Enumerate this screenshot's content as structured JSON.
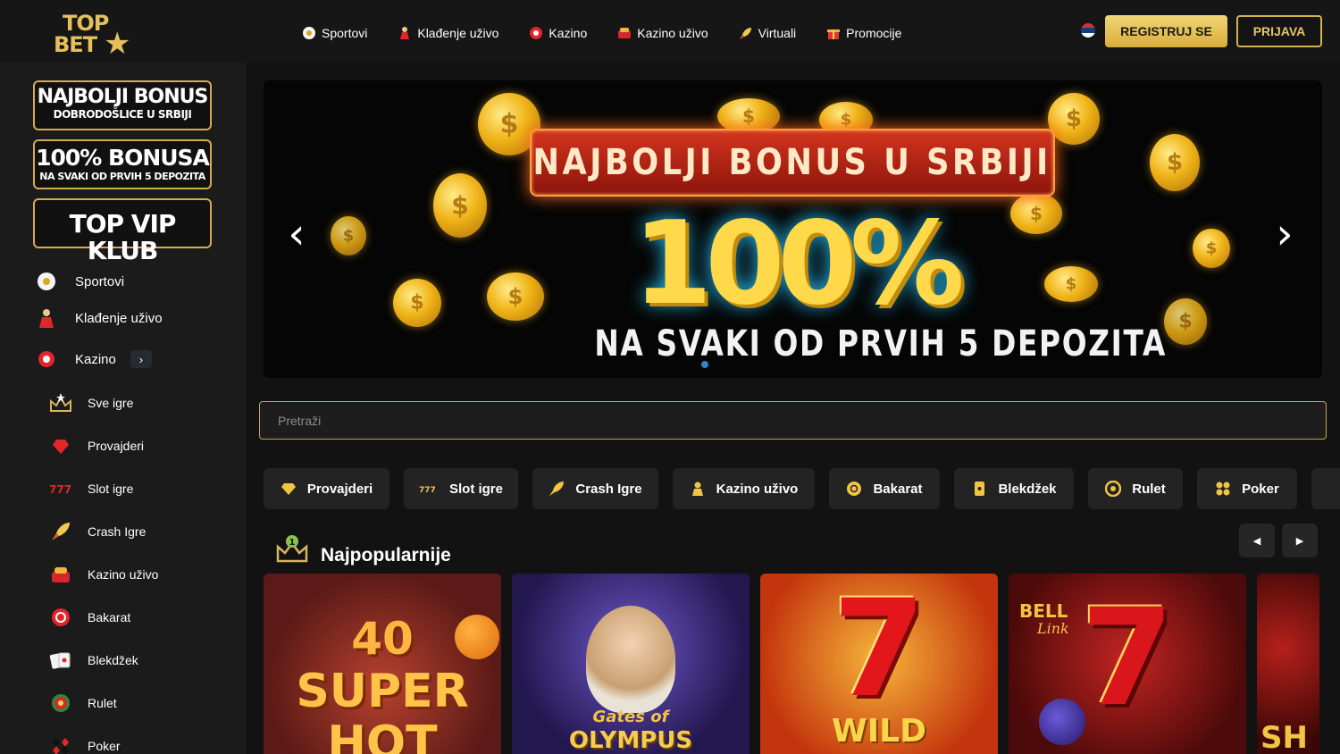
{
  "brand": {
    "line1": "TOP",
    "line2": "BET",
    "star": "★"
  },
  "topnav": [
    {
      "label": "Sportovi",
      "icon": "soccer-ball-icon"
    },
    {
      "label": "Klađenje uživo",
      "icon": "live-player-icon"
    },
    {
      "label": "Kazino",
      "icon": "casino-chip-icon"
    },
    {
      "label": "Kazino uživo",
      "icon": "live-casino-icon"
    },
    {
      "label": "Virtuali",
      "icon": "rocket-icon"
    },
    {
      "label": "Promocije",
      "icon": "gift-icon"
    }
  ],
  "header": {
    "register_label": "REGISTRUJ SE",
    "login_label": "PRIJAVA",
    "language_icon": "serbia-flag-icon"
  },
  "sidebar": {
    "promos": [
      {
        "big": "NAJBOLJI BONUS",
        "small": "DOBRODOŠLICE U SRBIJI"
      },
      {
        "big": "100% BONUSA",
        "small": "NA SVAKI OD PRVIH 5 DEPOZITA"
      },
      {
        "big": "TOP VIP KLUB",
        "small": ""
      }
    ],
    "main_items": [
      {
        "label": "Sportovi",
        "icon": "soccer-ball-icon"
      },
      {
        "label": "Klađenje uživo",
        "icon": "live-player-icon"
      },
      {
        "label": "Kazino",
        "icon": "casino-chip-icon",
        "expand": "›"
      }
    ],
    "sub_items": [
      {
        "label": "Sve igre",
        "icon": "crown-star-icon"
      },
      {
        "label": "Provajderi",
        "icon": "diamond-heart-icon"
      },
      {
        "label": "Slot igre",
        "icon": "triple-seven-icon"
      },
      {
        "label": "Crash Igre",
        "icon": "rocket-icon"
      },
      {
        "label": "Kazino uživo",
        "icon": "live-casino-icon"
      },
      {
        "label": "Bakarat",
        "icon": "poker-chip-icon"
      },
      {
        "label": "Blekdžek",
        "icon": "playing-cards-icon"
      },
      {
        "label": "Rulet",
        "icon": "roulette-icon"
      },
      {
        "label": "Poker",
        "icon": "card-suits-icon"
      }
    ]
  },
  "banner": {
    "headline": "NAJBOLJI BONUS U SRBIJI",
    "percent": "100%",
    "subline": "NA SVAKI OD PRVIH 5 DEPOZITA",
    "prev": "‹",
    "next": "›"
  },
  "search": {
    "placeholder": "Pretraži"
  },
  "categories": [
    {
      "label": "Provajderi",
      "icon": "diamond-icon"
    },
    {
      "label": "Slot igre",
      "icon": "triple-seven-icon"
    },
    {
      "label": "Crash Igre",
      "icon": "rocket-icon"
    },
    {
      "label": "Kazino uživo",
      "icon": "dealer-icon"
    },
    {
      "label": "Bakarat",
      "icon": "chip-icon"
    },
    {
      "label": "Blekdžek",
      "icon": "card-icon"
    },
    {
      "label": "Rulet",
      "icon": "roulette-icon"
    },
    {
      "label": "Poker",
      "icon": "clover-icon"
    }
  ],
  "section": {
    "title": "Najpopularnije",
    "rank": "1",
    "prev": "◀",
    "next": "▶"
  },
  "games": [
    {
      "name": "40 SUPER HOT",
      "lines": [
        "40",
        "SUPER",
        "HOT"
      ]
    },
    {
      "name": "Gates of Olympus",
      "lines": [
        "Gates of",
        "OLYMPUS"
      ]
    },
    {
      "name": "7 WILD",
      "lines": [
        "7",
        "WILD"
      ]
    },
    {
      "name": "Bell Link 7",
      "lines": [
        "BELL",
        "Link",
        "7"
      ]
    },
    {
      "name": "Sh",
      "lines": [
        "SH"
      ]
    }
  ],
  "colors": {
    "gold": "#d7b050",
    "background": "#121212",
    "sidebar": "#1b1b1b",
    "chip": "#232323"
  }
}
